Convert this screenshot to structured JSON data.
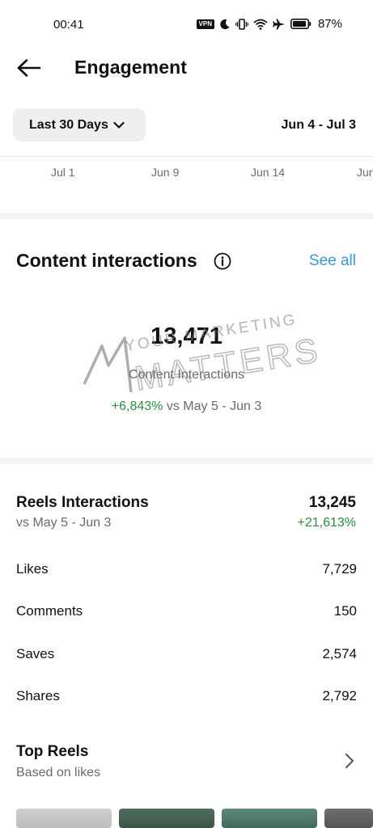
{
  "status_bar": {
    "time": "00:41",
    "vpn_label": "VPN",
    "battery_percent": "87%",
    "icons": [
      "vpn-icon",
      "moon-icon",
      "vibrate-icon",
      "wifi-icon",
      "airplane-icon",
      "battery-icon"
    ]
  },
  "header": {
    "title": "Engagement",
    "back_icon": "arrow-left-icon"
  },
  "filters": {
    "range_label": "Last 30 Days",
    "date_range": "Jun 4 - Jul 3"
  },
  "chart_axis": {
    "labels": [
      "Jul 1",
      "Jun 9",
      "Jun 14",
      "Jun"
    ]
  },
  "content_interactions": {
    "heading": "Content interactions",
    "see_all": "See all",
    "total": "13,471",
    "total_label": "Content Interactions",
    "change": "+6,843%",
    "comparison": " vs May 5 - Jun 3"
  },
  "reels": {
    "title": "Reels Interactions",
    "comparison": "vs May 5 - Jun 3",
    "total": "13,245",
    "change": "+21,613%",
    "metrics": [
      {
        "label": "Likes",
        "value": "7,729"
      },
      {
        "label": "Comments",
        "value": "150"
      },
      {
        "label": "Saves",
        "value": "2,574"
      },
      {
        "label": "Shares",
        "value": "2,792"
      }
    ]
  },
  "top_reels": {
    "title": "Top Reels",
    "subtitle": "Based on likes"
  },
  "watermark": {
    "line1": "YOUR MARKETING",
    "line2": "MATTERS"
  },
  "colors": {
    "accent_link": "#3897d6",
    "positive": "#2e8b3e",
    "muted_text": "#6b6b6b"
  }
}
